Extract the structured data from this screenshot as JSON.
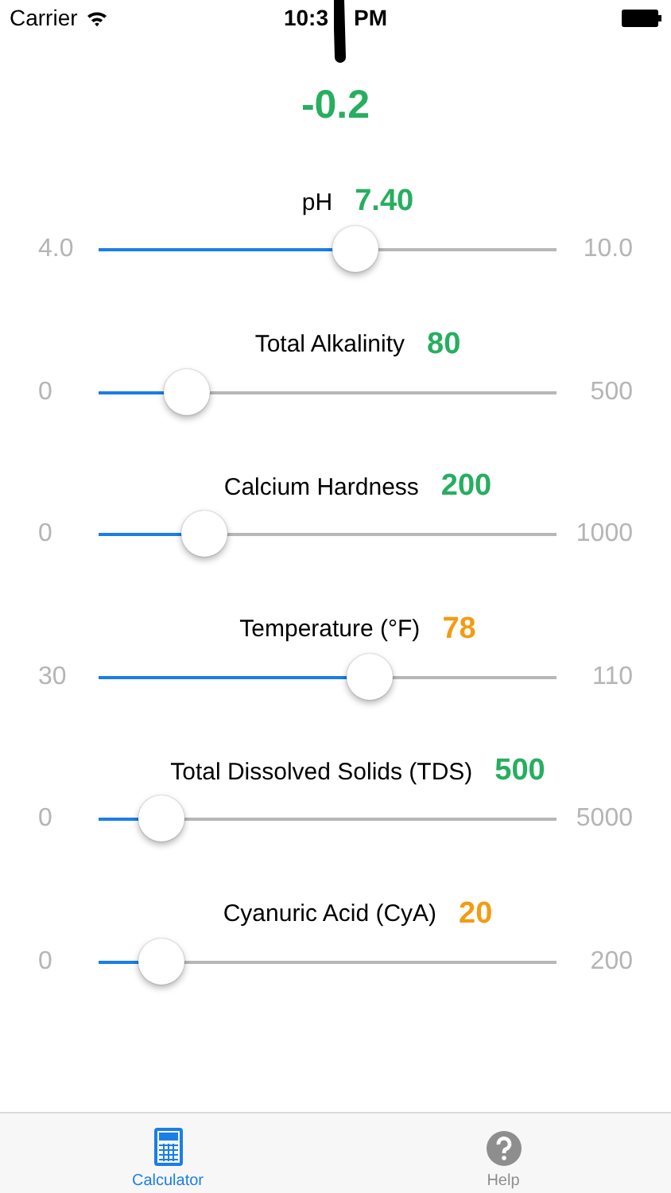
{
  "status_bar": {
    "carrier": "Carrier",
    "time_left": "10:3",
    "time_right": "PM"
  },
  "result": {
    "value": "-0.2",
    "color": "#27ae60"
  },
  "parameters": [
    {
      "label": "pH",
      "value": "7.40",
      "color": "#27ae60",
      "min": "4.0",
      "max": "10.0",
      "level": 0.56
    },
    {
      "label": "Total Alkalinity",
      "value": "80",
      "color": "#27ae60",
      "min": "0",
      "max": "500",
      "level": 0.19
    },
    {
      "label": "Calcium Hardness",
      "value": "200",
      "color": "#27ae60",
      "min": "0",
      "max": "1000",
      "level": 0.23
    },
    {
      "label": "Temperature (°F)",
      "value": "78",
      "color": "#f39c12",
      "min": "30",
      "max": "110",
      "level": 0.59
    },
    {
      "label": "Total Dissolved Solids (TDS)",
      "value": "500",
      "color": "#27ae60",
      "min": "0",
      "max": "5000",
      "level": 0.135
    },
    {
      "label": "Cyanuric Acid (CyA)",
      "value": "20",
      "color": "#f39c12",
      "min": "0",
      "max": "200",
      "level": 0.135
    }
  ],
  "tabs": [
    {
      "label": "Calculator",
      "kind": "calculator",
      "selected": true
    },
    {
      "label": "Help",
      "kind": "help",
      "selected": false
    }
  ]
}
